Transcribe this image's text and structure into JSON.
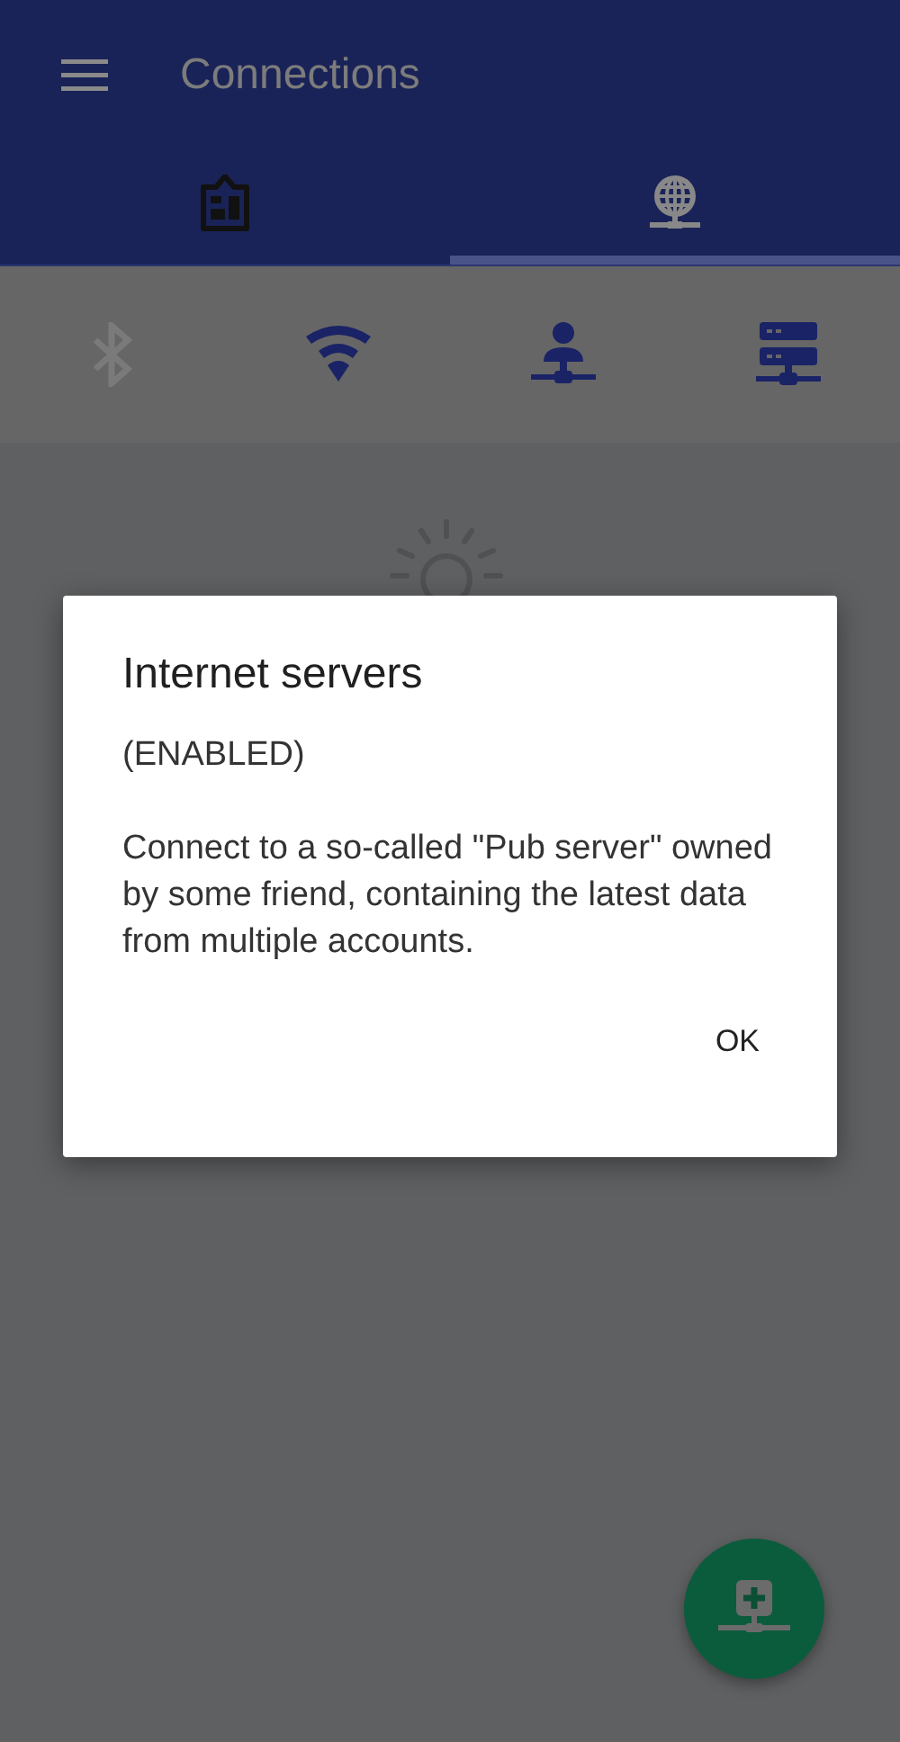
{
  "app_bar": {
    "title": "Connections"
  },
  "tabs": [
    {
      "kind": "board",
      "selected": false
    },
    {
      "kind": "globe",
      "selected": true
    }
  ],
  "connection_types": [
    {
      "kind": "bluetooth",
      "enabled": false
    },
    {
      "kind": "wifi",
      "enabled": true
    },
    {
      "kind": "person",
      "enabled": true
    },
    {
      "kind": "server",
      "enabled": true
    }
  ],
  "dialog": {
    "title": "Internet servers",
    "status": "(ENABLED)",
    "message": "Connect to a so-called \"Pub server\" owned by some friend, containing the latest data from multiple accounts.",
    "buttons": [
      "OK"
    ]
  }
}
